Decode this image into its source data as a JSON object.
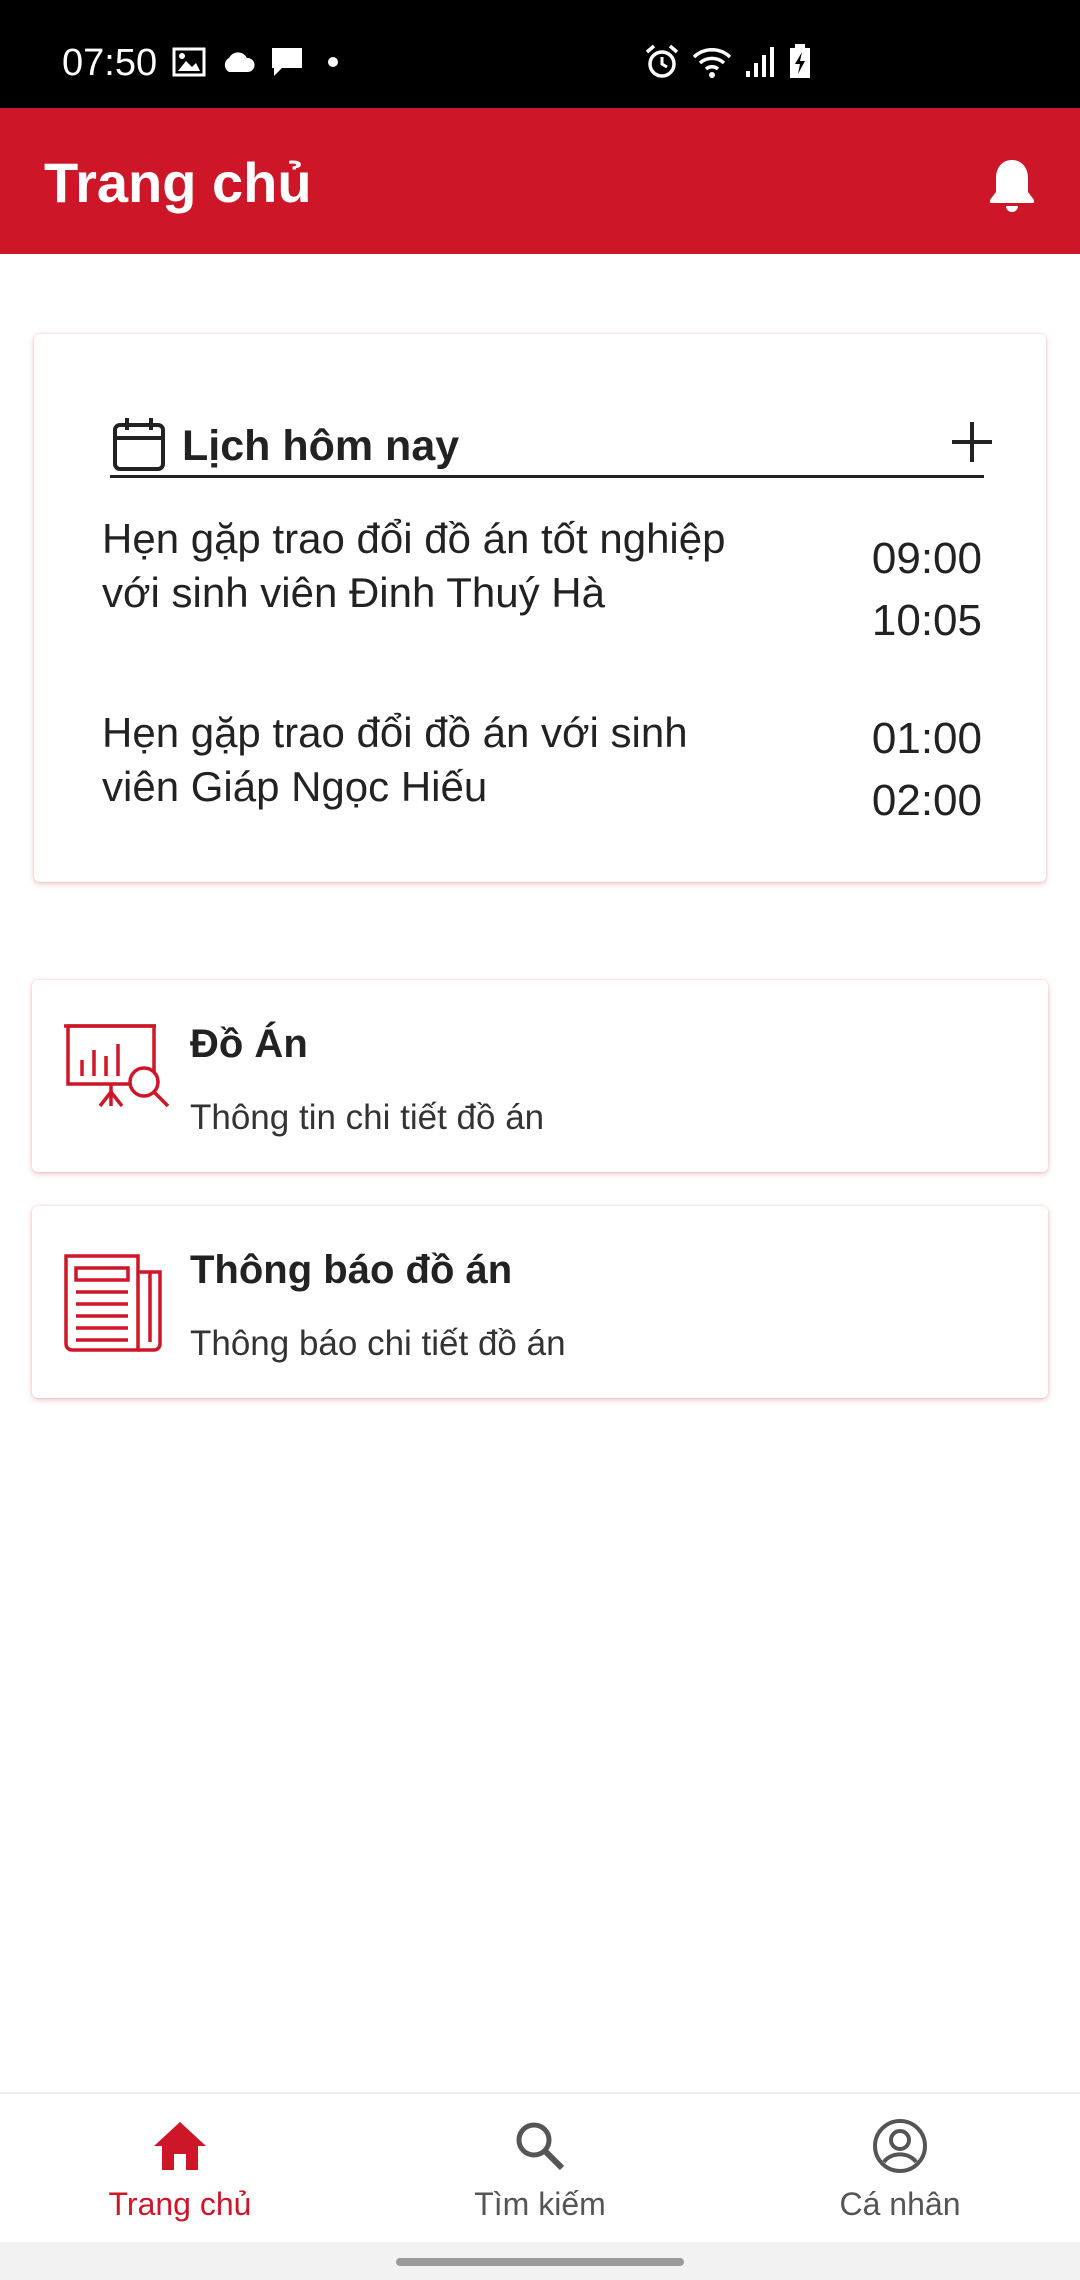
{
  "status_bar": {
    "time": "07:50",
    "left_icons": [
      "image-icon",
      "cloud-icon",
      "message-icon",
      "dot-icon"
    ],
    "right_icons": [
      "alarm-icon",
      "wifi-icon",
      "signal-icon",
      "battery-charging-icon"
    ]
  },
  "app_bar": {
    "title": "Trang chủ",
    "notification_icon": "bell-icon"
  },
  "schedule": {
    "title": "Lịch hôm nay",
    "add_icon": "plus-icon",
    "events": [
      {
        "title": "Hẹn gặp trao đổi đồ án tốt nghiệp với sinh viên Đinh Thuý Hà",
        "start": "09:00",
        "end": "10:05"
      },
      {
        "title": "Hẹn gặp trao đổi đồ án với sinh viên Giáp Ngọc Hiếu",
        "start": "01:00",
        "end": "02:00"
      }
    ]
  },
  "menu": [
    {
      "title": "Đồ Án",
      "subtitle": "Thông tin chi tiết đồ án",
      "icon": "presentation-search-icon"
    },
    {
      "title": "Thông báo đồ án",
      "subtitle": "Thông báo chi tiết đồ án",
      "icon": "newspaper-icon"
    }
  ],
  "bottom_nav": {
    "items": [
      {
        "label": "Trang chủ",
        "icon": "home-icon",
        "active": true
      },
      {
        "label": "Tìm kiếm",
        "icon": "search-icon",
        "active": false
      },
      {
        "label": "Cá nhân",
        "icon": "account-circle-icon",
        "active": false
      }
    ]
  },
  "colors": {
    "primary": "#cd1628",
    "inactive_nav": "#555555",
    "text": "#222222"
  }
}
